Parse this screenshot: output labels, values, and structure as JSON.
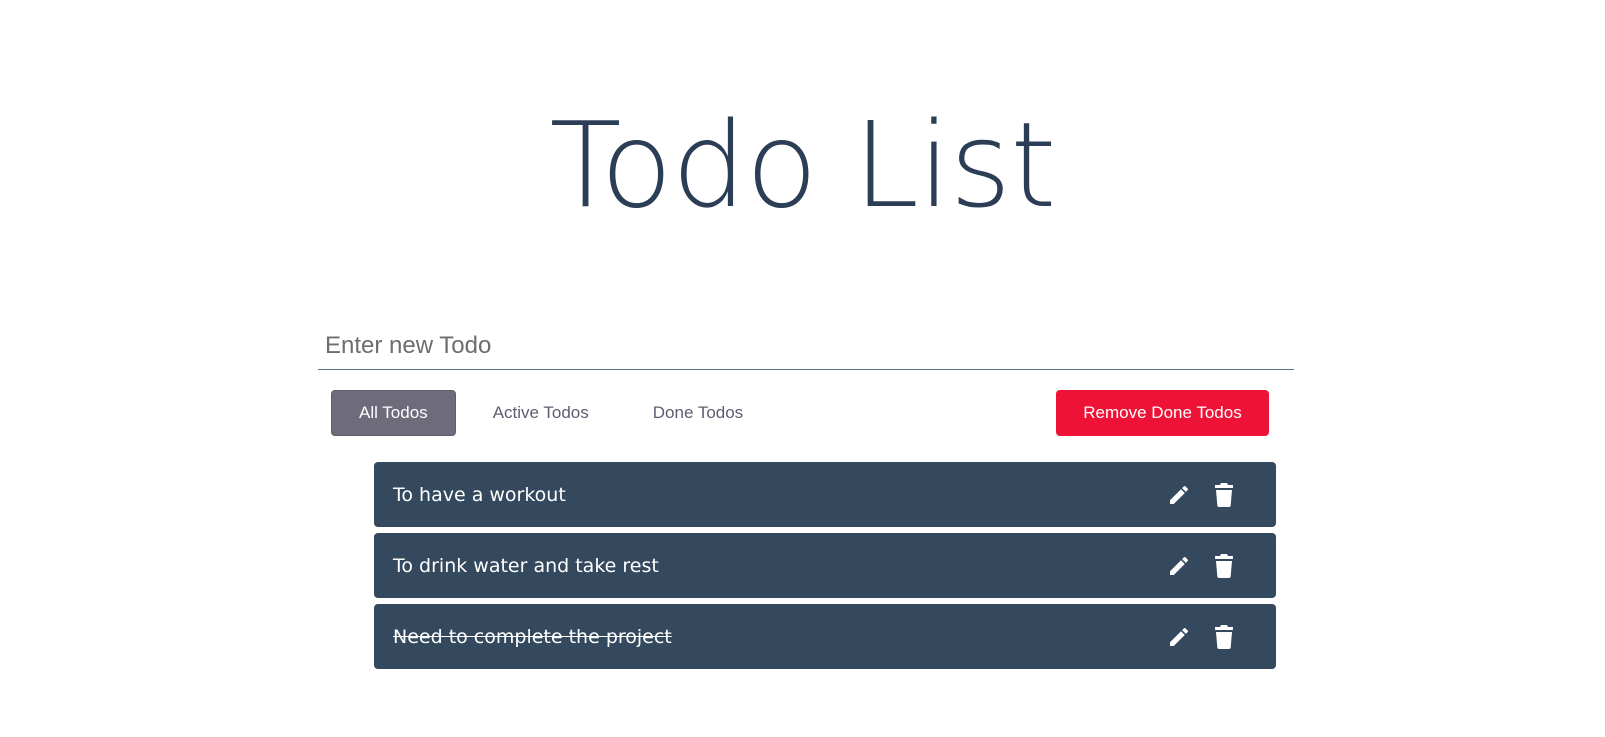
{
  "header": {
    "title": "Todo List"
  },
  "input": {
    "placeholder": "Enter new Todo",
    "value": ""
  },
  "filters": [
    {
      "label": "All Todos",
      "active": true
    },
    {
      "label": "Active Todos",
      "active": false
    },
    {
      "label": "Done Todos",
      "active": false
    }
  ],
  "actions": {
    "remove_done_label": "Remove Done Todos"
  },
  "todos": [
    {
      "text": "To have a workout",
      "done": false
    },
    {
      "text": "To drink water and take rest",
      "done": false
    },
    {
      "text": "Need to complete the project",
      "done": true
    }
  ],
  "icons": {
    "edit": "pencil-icon",
    "delete": "trash-icon"
  },
  "colors": {
    "title": "#2c3e55",
    "todo_bg": "#34495e",
    "active_filter_bg": "#6e6b7b",
    "remove_btn_bg": "#ee1236"
  }
}
